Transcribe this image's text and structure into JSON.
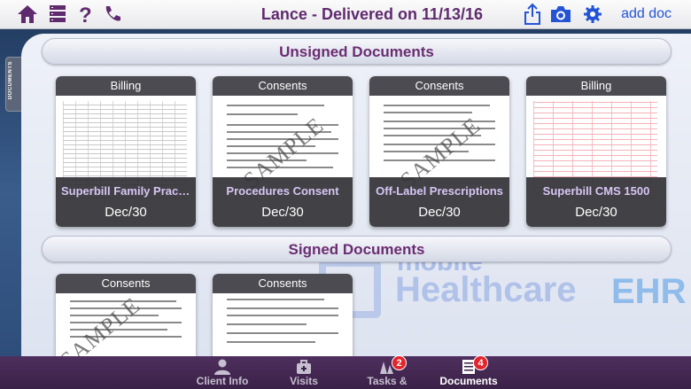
{
  "header": {
    "title": "Lance - Delivered on 11/13/16",
    "add_doc_label": "add doc",
    "icons": [
      "home-icon",
      "server-icon",
      "help-icon",
      "phone-icon",
      "share-icon",
      "camera-icon",
      "gear-icon"
    ]
  },
  "side_tab": {
    "label": "DOCUMENTS"
  },
  "unsigned": {
    "heading": "Unsigned Documents",
    "cards": [
      {
        "type": "Billing",
        "name": "Superbill Family Practice",
        "date": "Dec/30"
      },
      {
        "type": "Consents",
        "name": "Procedures Consent",
        "date": "Dec/30"
      },
      {
        "type": "Consents",
        "name": "Off-Label Prescriptions",
        "date": "Dec/30"
      },
      {
        "type": "Billing",
        "name": "Superbill CMS 1500",
        "date": "Dec/30"
      }
    ]
  },
  "signed": {
    "heading": "Signed Documents",
    "cards": [
      {
        "type": "Consents"
      },
      {
        "type": "Consents"
      }
    ]
  },
  "watermark": {
    "mobile": "mobile",
    "health": "Healthcare",
    "ehr": "EHR"
  },
  "sample_text": "SAMPLE",
  "tabs": [
    {
      "label": "Client Info",
      "icon": "person-icon"
    },
    {
      "label": "Visits",
      "icon": "bag-icon"
    },
    {
      "label": "Tasks & Billing",
      "icon": "tasks-icon",
      "badge": "2"
    },
    {
      "label": "Documents",
      "icon": "documents-icon",
      "badge": "4",
      "active": true
    }
  ],
  "colors": {
    "accent_purple": "#5f2a6e",
    "link_blue": "#2454d6",
    "badge_red": "#e3242b"
  }
}
